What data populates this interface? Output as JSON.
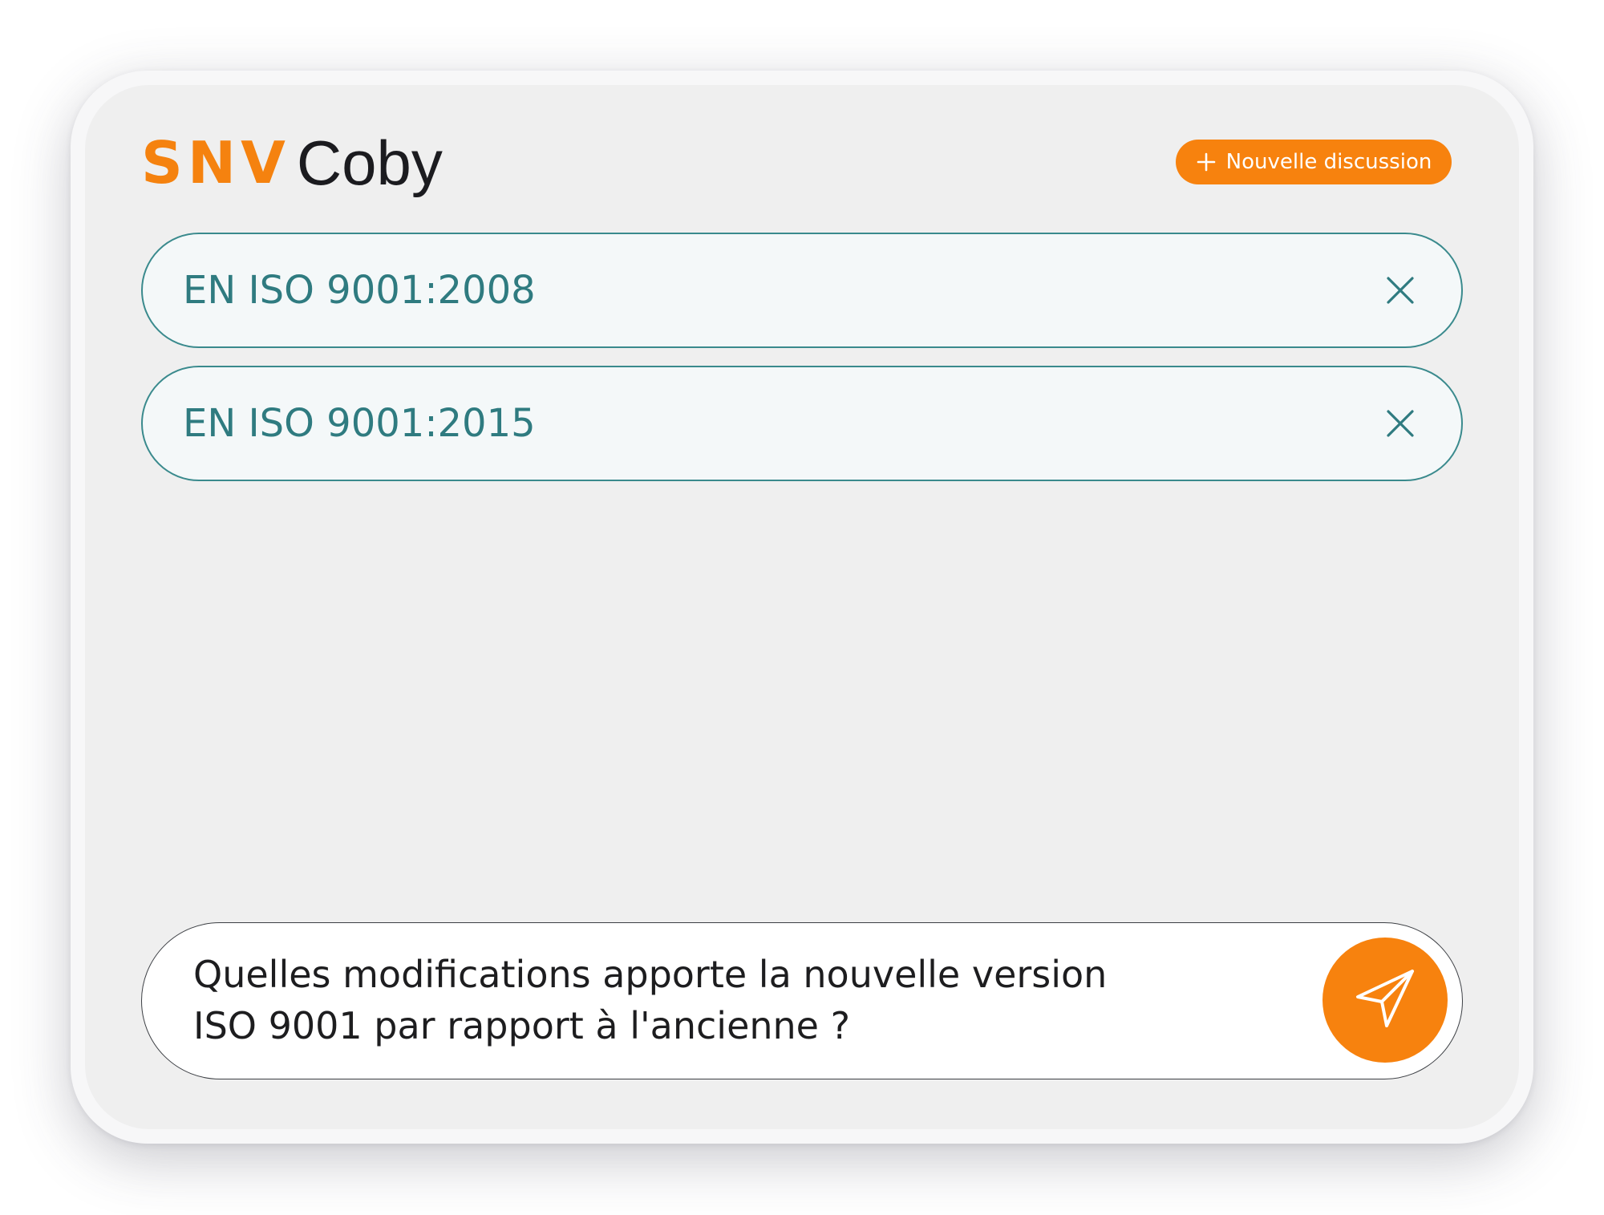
{
  "brand": {
    "primary": "SNV",
    "secondary": "Coby",
    "accent_color": "#f7820e",
    "teal_color": "#2f7b80"
  },
  "header": {
    "new_chat_label": "Nouvelle discussion",
    "new_chat_icon": "plus-icon"
  },
  "documents": [
    {
      "label": "EN ISO 9001:2008",
      "remove_icon": "close-icon"
    },
    {
      "label": "EN ISO 9001:2015",
      "remove_icon": "close-icon"
    }
  ],
  "composer": {
    "value": "Quelles modifications apporte la nouvelle version\nISO 9001 par rapport à l'ancienne ?",
    "send_icon": "send-icon"
  }
}
